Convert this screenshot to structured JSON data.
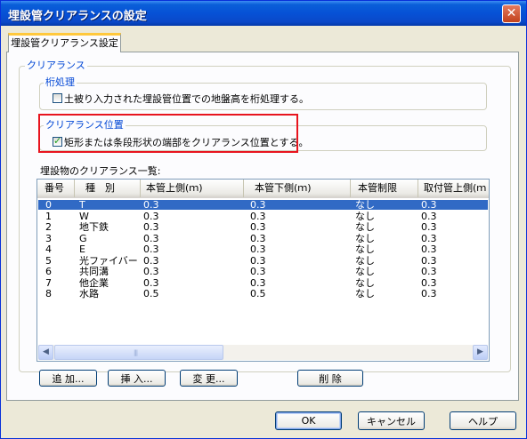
{
  "window": {
    "title": "埋設管クリアランスの設定",
    "close_glyph": "✕"
  },
  "tab": {
    "label": "埋設管クリアランス設定"
  },
  "clearance_group": {
    "legend": "クリアランス"
  },
  "digit_group": {
    "legend": "桁処理",
    "checkbox_label": "土被り入力された埋設管位置での地盤高を桁処理する。",
    "checked": false
  },
  "position_group": {
    "legend": "クリアランス位置",
    "checkbox_label": "矩形または条段形状の端部をクリアランス位置とする。",
    "checked": true,
    "highlight_color": "#e8141e"
  },
  "list": {
    "caption": "埋設物のクリアランス一覧:",
    "columns": [
      "番号",
      "種　別",
      "本管上側(ｍ)",
      "本管下側(ｍ)",
      "本管制限",
      "取付管上側(ｍ"
    ],
    "rows": [
      [
        "0",
        "T",
        "0.3",
        "0.3",
        "なし",
        "0.3"
      ],
      [
        "1",
        "W",
        "0.3",
        "0.3",
        "なし",
        "0.3"
      ],
      [
        "2",
        "地下鉄",
        "0.3",
        "0.3",
        "なし",
        "0.3"
      ],
      [
        "3",
        "G",
        "0.3",
        "0.3",
        "なし",
        "0.3"
      ],
      [
        "4",
        "E",
        "0.3",
        "0.3",
        "なし",
        "0.3"
      ],
      [
        "5",
        "光ファイバー",
        "0.3",
        "0.3",
        "なし",
        "0.3"
      ],
      [
        "6",
        "共同溝",
        "0.3",
        "0.3",
        "なし",
        "0.3"
      ],
      [
        "7",
        "他企業",
        "0.3",
        "0.3",
        "なし",
        "0.3"
      ],
      [
        "8",
        "水路",
        "0.5",
        "0.5",
        "なし",
        "0.3"
      ]
    ],
    "selected_index": 0,
    "selection_color": "#316ac5"
  },
  "list_buttons": {
    "add": "追 加...",
    "insert": "挿 入...",
    "change": "変 更...",
    "delete": "削 除"
  },
  "dialog_buttons": {
    "ok": "OK",
    "cancel": "キャンセル",
    "help": "ヘルプ"
  },
  "icons": {
    "scroll_left": "◀",
    "scroll_right": "▶",
    "scroll_grip": "|||"
  },
  "colors": {
    "titlebar": "#0651d6",
    "dialog_bg": "#ece9d8",
    "legend_text": "#0046d5"
  }
}
